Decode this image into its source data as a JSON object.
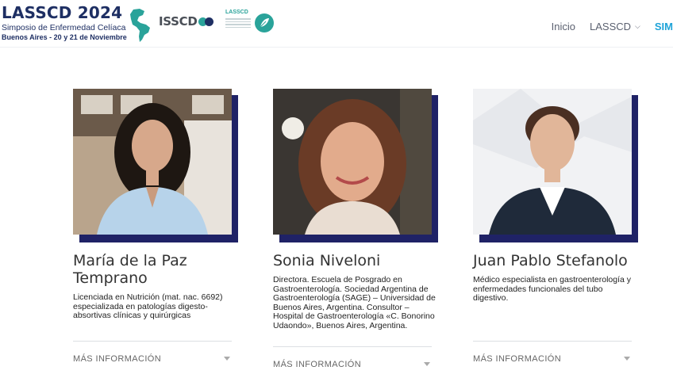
{
  "header": {
    "logo_title": "LASSCD 2024",
    "logo_subtitle": "Simposio de Enfermedad Celíaca",
    "logo_location": "Buenos Aires - 20 y 21 de Noviembre",
    "isscd_text": "ISSCD",
    "lasscd_small": "LASSCD",
    "brand_navy": "#1e2f63",
    "brand_teal": "#2aa39a"
  },
  "nav": {
    "items": [
      {
        "label": "Inicio"
      },
      {
        "label": "LASSCD",
        "icon": "chevron-down-icon"
      },
      {
        "label": "SIM"
      }
    ],
    "active_color": "#1fa3d8"
  },
  "speakers": [
    {
      "name": "María de la Paz Temprano",
      "description": "Licenciada en Nutrición (mat. nac. 6692) especializada en patologías digesto-absortivas clínicas y quirúrgicas",
      "more_label": "MÁS INFORMACIÓN"
    },
    {
      "name": "Sonia Niveloni",
      "description": "Directora. Escuela de Posgrado en Gastroenterología. Sociedad Argentina de Gastroenterología (SAGE) – Universidad de Buenos Aires, Argentina. Consultor – Hospital de Gastroenterología «C. Bonorino Udaondo», Buenos Aires, Argentina.",
      "more_label": "MÁS INFORMACIÓN"
    },
    {
      "name": "Juan Pablo Stefanolo",
      "description": "Médico especialista en gastroenterología y enfermedades funcionales del tubo digestivo.",
      "more_label": "MÁS INFORMACIÓN"
    }
  ],
  "accent_shadow": "#1f2266"
}
